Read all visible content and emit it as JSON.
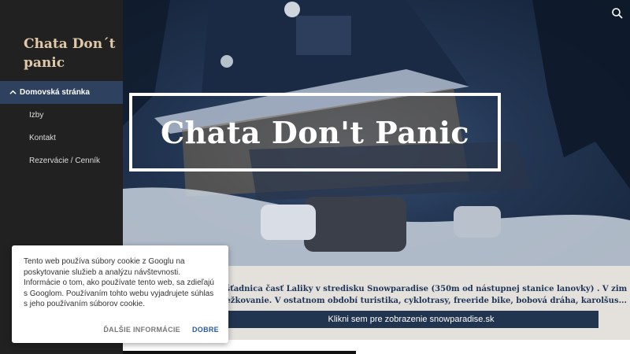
{
  "site": {
    "title": "Chata Don´t panic"
  },
  "nav": {
    "items": [
      {
        "label": "Domovská stránka",
        "active": true
      },
      {
        "label": "Izby"
      },
      {
        "label": "Kontakt"
      },
      {
        "label": "Rezervácie / Cenník"
      }
    ]
  },
  "hero": {
    "title": "Chata Don't Panic"
  },
  "info": {
    "line1": "...šťadnica časť Laliky v stredisku Snowparadise (350m od nástupnej stanice lanovky) . V zimnom obdobi",
    "line2": "...ežkovanie. V ostatnom období turistika, cyklotrasy, freeride bike, bobová dráha, karolšus...",
    "button_label": "Klikni sem pre zobrazenie snowparadise.sk"
  },
  "cookie": {
    "text": "Tento web používa súbory cookie z Googlu na poskytovanie služieb a analýzu návštevnosti. Informácie o tom, ako používate tento web, sa zdieľajú s Googlom. Používaním tohto webu vyjadrujete súhlas s jeho používaním súborov cookie.",
    "more_label": "ĎALŠIE INFORMÁCIE",
    "ok_label": "DOBRE"
  },
  "colors": {
    "sidebar_bg": "#212121",
    "title_color": "#e0c9a8",
    "accent": "#2e4260",
    "button_bg": "#213550",
    "link_blue": "#2b58a3"
  },
  "icons": {
    "search": "search-icon",
    "active_nav": "chevron-up-icon"
  }
}
